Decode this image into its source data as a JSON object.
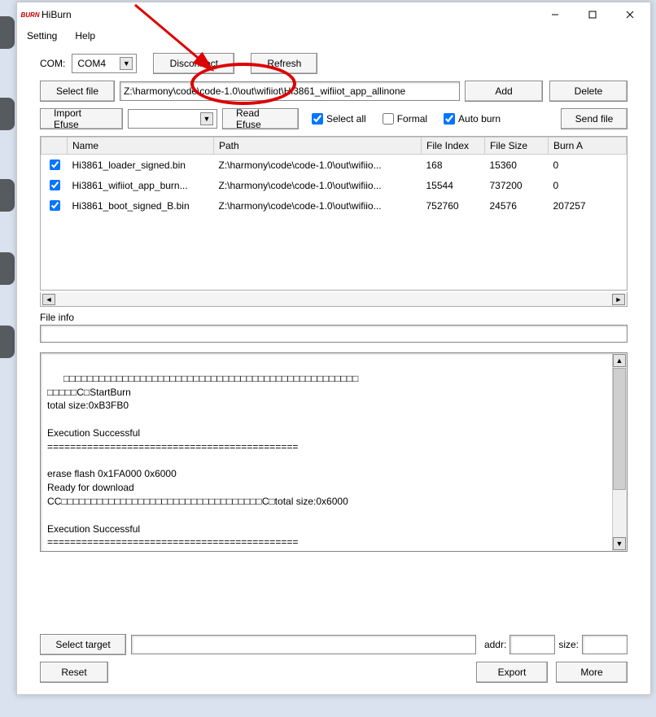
{
  "window": {
    "title": "HiBurn"
  },
  "menu": {
    "setting": "Setting",
    "help": "Help"
  },
  "com": {
    "label": "COM:",
    "value": "COM4",
    "disconnect": "Disconnect",
    "refresh": "Refresh"
  },
  "file": {
    "select_file": "Select file",
    "path": "Z:\\harmony\\code\\code-1.0\\out\\wifiiot\\Hi3861_wifiiot_app_allinone",
    "add": "Add",
    "delete": "Delete"
  },
  "efuse": {
    "import": "Import Efuse",
    "combo": "",
    "read": "Read Efuse",
    "select_all": "Select all",
    "formal": "Formal",
    "auto_burn": "Auto burn",
    "send_file": "Send file",
    "select_all_checked": true,
    "formal_checked": false,
    "auto_burn_checked": true
  },
  "table": {
    "headers": {
      "name": "Name",
      "path": "Path",
      "file_index": "File Index",
      "file_size": "File Size",
      "burn_addr": "Burn A"
    },
    "rows": [
      {
        "checked": true,
        "name": "Hi3861_loader_signed.bin",
        "path": "Z:\\harmony\\code\\code-1.0\\out\\wifiio...",
        "file_index": "168",
        "file_size": "15360",
        "burn_addr": "0"
      },
      {
        "checked": true,
        "name": "Hi3861_wifiiot_app_burn...",
        "path": "Z:\\harmony\\code\\code-1.0\\out\\wifiio...",
        "file_index": "15544",
        "file_size": "737200",
        "burn_addr": "0"
      },
      {
        "checked": true,
        "name": "Hi3861_boot_signed_B.bin",
        "path": "Z:\\harmony\\code\\code-1.0\\out\\wifiio...",
        "file_index": "752760",
        "file_size": "24576",
        "burn_addr": "207257"
      }
    ]
  },
  "fileinfo": {
    "label": "File info",
    "value": ""
  },
  "log": "□□□□□□□□□□□□□□□□□□□□□□□□□□□□□□□□□□□□□□□□□□□□□□□□□□\n□□□□□C□StartBurn\ntotal size:0xB3FB0\n\nExecution Successful\n============================================\n\nerase flash 0x1FA000 0x6000\nReady for download\nCC□□□□□□□□□□□□□□□□□□□□□□□□□□□□□□□□□□C□total size:0x6000\n\nExecution Successful\n============================================\n\nWait connect success flag (hisilicon) overtime.",
  "bottom": {
    "select_target": "Select target",
    "target_value": "",
    "addr_label": "addr:",
    "addr_value": "",
    "size_label": "size:",
    "size_value": "",
    "reset": "Reset",
    "export": "Export",
    "more": "More"
  }
}
